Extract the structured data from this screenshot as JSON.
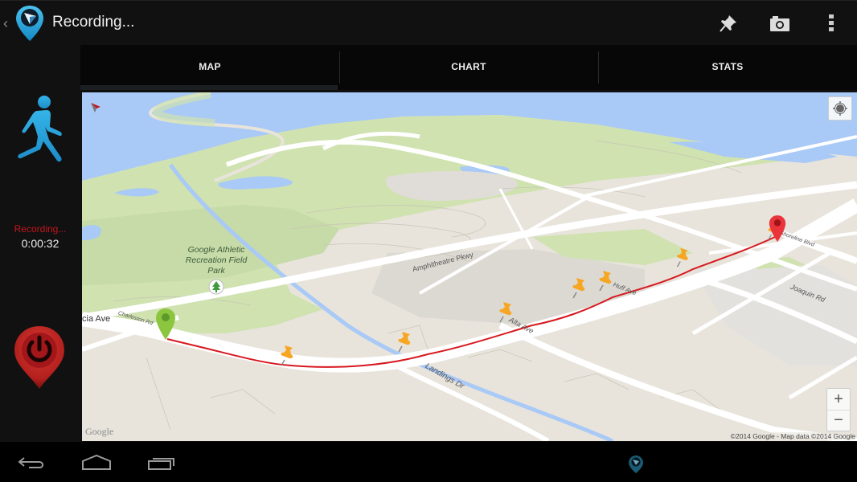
{
  "actionbar": {
    "title": "Recording...",
    "icons": {
      "back": "chevron-left-icon",
      "logo": "app-location-pin-logo",
      "pin": "pushpin-icon",
      "camera": "camera-icon",
      "overflow": "overflow-menu-icon"
    }
  },
  "leftpanel": {
    "activity": "walking-icon",
    "status_label": "Recording...",
    "elapsed_time": "0:00:32",
    "stop_button": "power-stop-icon"
  },
  "tabs": [
    {
      "label": "MAP",
      "active": true
    },
    {
      "label": "CHART",
      "active": false
    },
    {
      "label": "STATS",
      "active": false
    }
  ],
  "map": {
    "park_label": "Google Athletic Recreation Field Park",
    "streets": {
      "charleston": "Charleston Rd",
      "garcia": "cia Ave",
      "amphitheatre": "Amphitheatre Pkwy",
      "alta": "Alta Ave",
      "landings": "Landings Dr",
      "huff": "Huff Ave",
      "shoreline": "N Shoreline Blvd",
      "joaquin": "Joaquin Rd"
    },
    "markers": {
      "start": "green start marker",
      "end": "red end marker",
      "waypoint_count": 7
    },
    "track_color": "#d7191f",
    "zoom_in": "+",
    "zoom_out": "−",
    "google_logo": "Google",
    "attribution": "©2014 Google - Map data ©2014 Google"
  },
  "navbar": {
    "back": "nav-back-icon",
    "home": "nav-home-icon",
    "recents": "nav-recents-icon",
    "notification": "app-notification-icon"
  },
  "colors": {
    "accent_blue": "#2aa7de",
    "recording_red": "#c4161c",
    "water": "#a9c9f6",
    "park": "#cfe2b0",
    "land": "#e8e4dc"
  }
}
